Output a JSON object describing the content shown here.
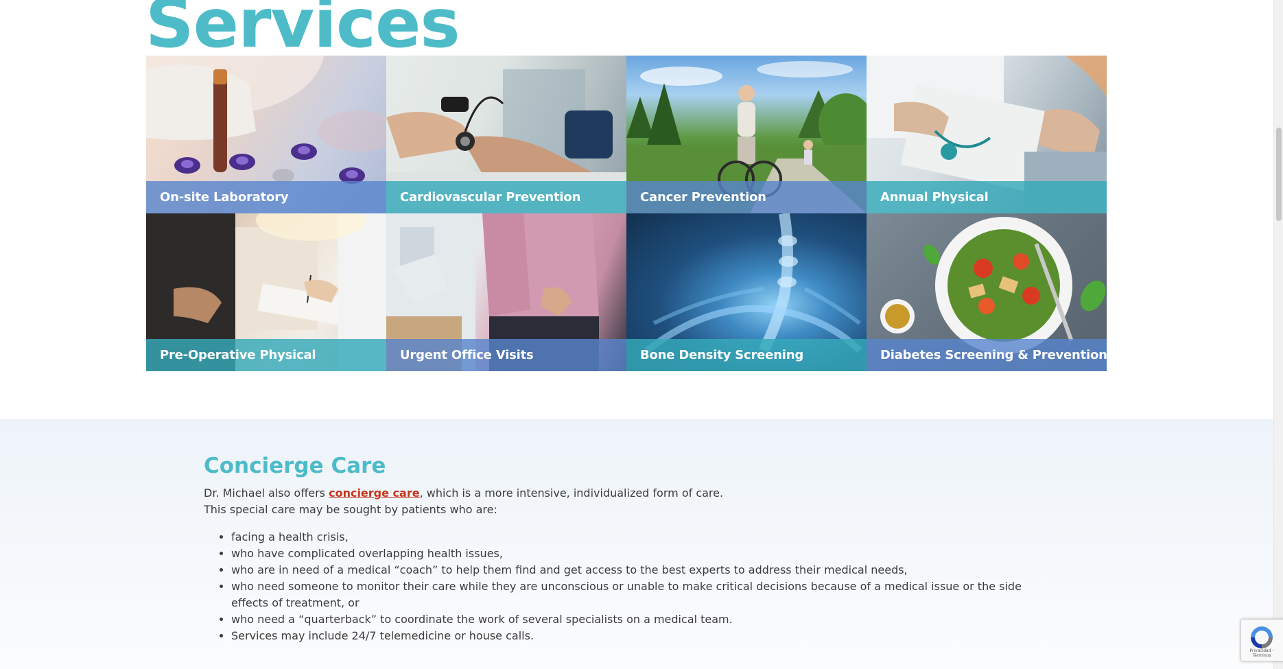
{
  "page": {
    "services_heading": "Services"
  },
  "services": [
    {
      "label": "On-site Laboratory",
      "bar_color": "blue",
      "icon": "lab-tubes-photo"
    },
    {
      "label": "Cardiovascular Prevention",
      "bar_color": "teal",
      "icon": "blood-pressure-photo"
    },
    {
      "label": "Cancer Prevention",
      "bar_color": "blue",
      "icon": "cycling-seniors-photo"
    },
    {
      "label": "Annual Physical",
      "bar_color": "teal",
      "icon": "stethoscope-clipboard-photo"
    },
    {
      "label": "Pre-Operative Physical",
      "bar_color": "teal",
      "icon": "consultation-photo"
    },
    {
      "label": "Urgent Office Visits",
      "bar_color": "blue",
      "icon": "back-pain-photo"
    },
    {
      "label": "Bone Density Screening",
      "bar_color": "teal",
      "icon": "xray-photo"
    },
    {
      "label": "Diabetes Screening & Prevention",
      "bar_color": "blue",
      "icon": "salad-photo"
    }
  ],
  "concierge": {
    "title": "Concierge Care",
    "intro_before": "Dr. Michael also offers ",
    "intro_link": "concierge care",
    "intro_after": ", which is a more intensive, individualized form of care.",
    "intro_line2": "This special care may be sought by patients who are:",
    "items": [
      "facing a health crisis,",
      "who have complicated overlapping health issues,",
      "who are in need of a medical “coach” to help them find and get access to the best experts to address their medical needs,",
      "who need someone to monitor their care while they are unconscious or unable to make critical decisions because of a medical issue or the side effects of treatment, or",
      "who need a “quarterback” to coordinate the work of several specialists on a medical team.",
      "Services may include 24/7 telemedicine or house calls."
    ]
  },
  "recaptcha": {
    "footer_text": "Privacidad - Términos"
  },
  "colors": {
    "heading_teal": "#4dbcc8",
    "bar_teal": "#36a9b9",
    "bar_blue": "#5885cd",
    "link_red": "#c8361c"
  }
}
